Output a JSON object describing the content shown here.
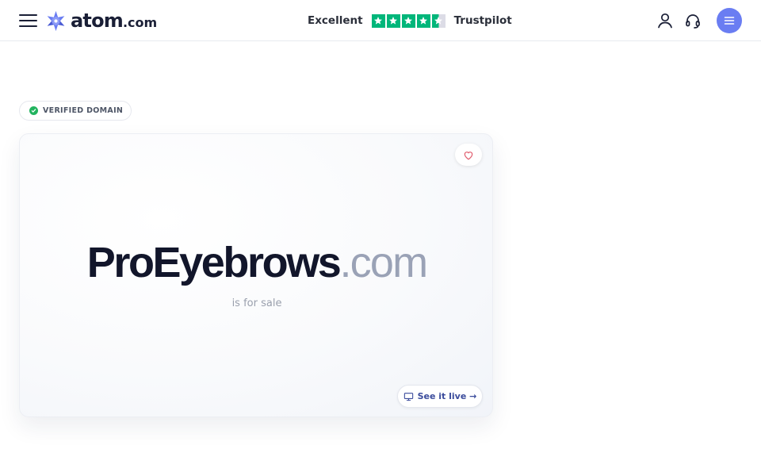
{
  "header": {
    "logo": {
      "word": "atom",
      "tld": ".com"
    },
    "trustpilot": {
      "rating_word": "Excellent",
      "brand": "Trustpilot",
      "stars_filled": 4.5,
      "stars_total": 5
    },
    "icons": [
      "hamburger-menu-icon",
      "user-icon",
      "headset-support-icon",
      "menu-lines-icon"
    ]
  },
  "badge": {
    "label": "VERIFIED DOMAIN"
  },
  "card": {
    "domain_name": "ProEyebrows",
    "domain_tld": ".com",
    "subtitle": "is for sale",
    "live_button": "See it live",
    "live_arrow": "→"
  },
  "colors": {
    "brand": "#6a7df2",
    "trustpilot_green": "#00b67a",
    "verified_green": "#22b35f",
    "heart": "#e05a6b",
    "link_blue": "#3b4c9c"
  }
}
